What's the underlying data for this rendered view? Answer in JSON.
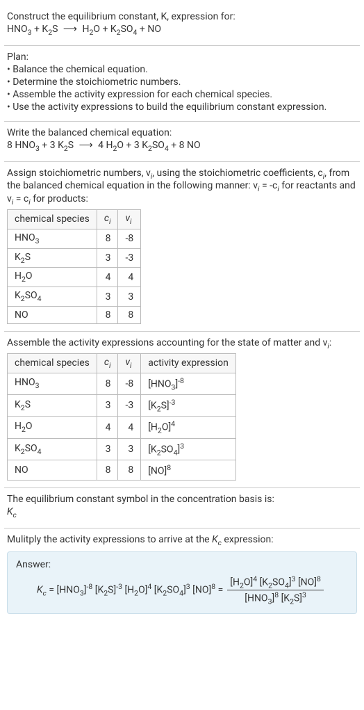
{
  "intro": {
    "line1": "Construct the equilibrium constant, K, expression for:",
    "eqn_lhs1": "HNO",
    "eqn_lhs1_sub": "3",
    "eqn_plus1": " + K",
    "eqn_lhs2_sub": "2",
    "eqn_lhs2b": "S ",
    "arrow": "⟶",
    "eqn_rhs1": " H",
    "eqn_rhs1_sub": "2",
    "eqn_rhs1b": "O + K",
    "eqn_rhs2_sub": "2",
    "eqn_rhs2b": "SO",
    "eqn_rhs3_sub": "4",
    "eqn_rhs3b": " + NO"
  },
  "plan": {
    "title": "Plan:",
    "items": [
      "• Balance the chemical equation.",
      "• Determine the stoichiometric numbers.",
      "• Assemble the activity expression for each chemical species.",
      "• Use the activity expressions to build the equilibrium constant expression."
    ]
  },
  "balanced": {
    "title": "Write the balanced chemical equation:",
    "c1": "8 HNO",
    "s1": "3",
    "c2": " + 3 K",
    "s2": "2",
    "c2b": "S ",
    "arrow": "⟶",
    "c3": " 4 H",
    "s3": "2",
    "c3b": "O + 3 K",
    "s4": "2",
    "c4b": "SO",
    "s5": "4",
    "c5b": " + 8 NO"
  },
  "stoich": {
    "desc1": "Assign stoichiometric numbers, ν",
    "desc1s": "i",
    "desc2": ", using the stoichiometric coefficients, c",
    "desc2s": "i",
    "desc3": ", from the balanced chemical equation in the following manner: ν",
    "desc3s": "i",
    "desc4": " = -c",
    "desc4s": "i",
    "desc5": " for reactants and ν",
    "desc5s": "i",
    "desc6": " = c",
    "desc6s": "i",
    "desc7": " for products:",
    "headers": {
      "h1": "chemical species",
      "h2": "c",
      "h2s": "i",
      "h3": "ν",
      "h3s": "i"
    },
    "rows": [
      {
        "sp_a": "HNO",
        "sp_s": "3",
        "sp_b": "",
        "c": "8",
        "v": "-8"
      },
      {
        "sp_a": "K",
        "sp_s": "2",
        "sp_b": "S",
        "c": "3",
        "v": "-3"
      },
      {
        "sp_a": "H",
        "sp_s": "2",
        "sp_b": "O",
        "c": "4",
        "v": "4"
      },
      {
        "sp_a": "K",
        "sp_s": "2",
        "sp_b": "SO",
        "sp_s2": "4",
        "c": "3",
        "v": "3"
      },
      {
        "sp_a": "NO",
        "sp_s": "",
        "sp_b": "",
        "c": "8",
        "v": "8"
      }
    ]
  },
  "activity": {
    "desc1": "Assemble the activity expressions accounting for the state of matter and ν",
    "desc1s": "i",
    "desc2": ":",
    "headers": {
      "h1": "chemical species",
      "h2": "c",
      "h2s": "i",
      "h3": "ν",
      "h3s": "i",
      "h4": "activity expression"
    },
    "rows": [
      {
        "sp_a": "HNO",
        "sp_s": "3",
        "sp_b": "",
        "c": "8",
        "v": "-8",
        "ae_a": "[HNO",
        "ae_s": "3",
        "ae_b": "]",
        "ae_sup": "-8"
      },
      {
        "sp_a": "K",
        "sp_s": "2",
        "sp_b": "S",
        "c": "3",
        "v": "-3",
        "ae_a": "[K",
        "ae_s": "2",
        "ae_b": "S]",
        "ae_sup": "-3"
      },
      {
        "sp_a": "H",
        "sp_s": "2",
        "sp_b": "O",
        "c": "4",
        "v": "4",
        "ae_a": "[H",
        "ae_s": "2",
        "ae_b": "O]",
        "ae_sup": "4"
      },
      {
        "sp_a": "K",
        "sp_s": "2",
        "sp_b": "SO",
        "sp_s2": "4",
        "c": "3",
        "v": "3",
        "ae_a": "[K",
        "ae_s": "2",
        "ae_b": "SO",
        "ae_s2": "4",
        "ae_c": "]",
        "ae_sup": "3"
      },
      {
        "sp_a": "NO",
        "sp_s": "",
        "sp_b": "",
        "c": "8",
        "v": "8",
        "ae_a": "[NO]",
        "ae_sup": "8"
      }
    ]
  },
  "kcsymbol": {
    "line1": "The equilibrium constant symbol in the concentration basis is:",
    "sym": "K",
    "sub": "c"
  },
  "multiply": {
    "line1a": "Mulitply the activity expressions to arrive at the ",
    "line1b": "K",
    "line1bs": "c",
    "line1c": " expression:"
  },
  "answer": {
    "label": "Answer:",
    "kc": "K",
    "kcs": "c",
    "eq": " = ",
    "t1a": "[HNO",
    "t1s": "3",
    "t1b": "]",
    "t1sup": "-8",
    "t2a": " [K",
    "t2s": "2",
    "t2b": "S]",
    "t2sup": "-3",
    "t3a": " [H",
    "t3s": "2",
    "t3b": "O]",
    "t3sup": "4",
    "t4a": " [K",
    "t4s": "2",
    "t4b": "SO",
    "t4s2": "4",
    "t4c": "]",
    "t4sup": "3",
    "t5a": " [NO]",
    "t5sup": "8",
    "eq2": " = ",
    "num1a": "[H",
    "num1s": "2",
    "num1b": "O]",
    "num1sup": "4",
    "num2a": " [K",
    "num2s": "2",
    "num2b": "SO",
    "num2s2": "4",
    "num2c": "]",
    "num2sup": "3",
    "num3a": " [NO]",
    "num3sup": "8",
    "den1a": "[HNO",
    "den1s": "3",
    "den1b": "]",
    "den1sup": "8",
    "den2a": " [K",
    "den2s": "2",
    "den2b": "S]",
    "den2sup": "3"
  }
}
